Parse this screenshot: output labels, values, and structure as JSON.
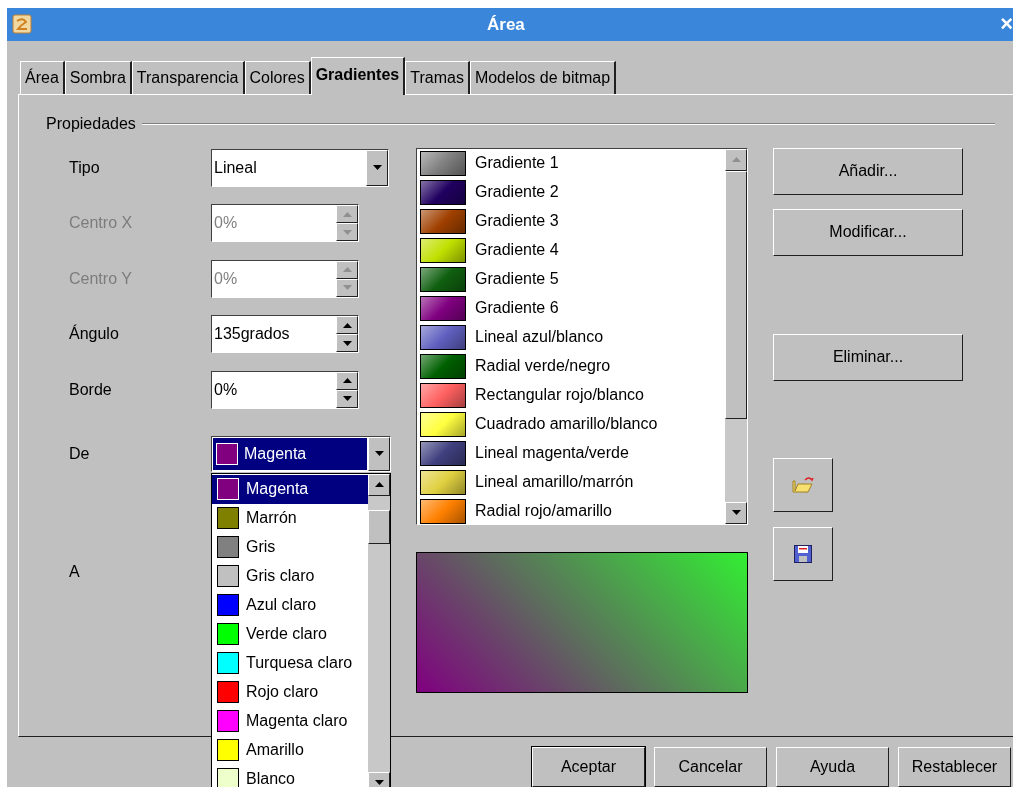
{
  "window": {
    "title": "Área",
    "close": "×"
  },
  "tabs": [
    {
      "label": "Área",
      "selected": false
    },
    {
      "label": "Sombra",
      "selected": false
    },
    {
      "label": "Transparencia",
      "selected": false
    },
    {
      "label": "Colores",
      "selected": false
    },
    {
      "label": "Gradientes",
      "selected": true
    },
    {
      "label": "Tramas",
      "selected": false
    },
    {
      "label": "Modelos de bitmap",
      "selected": false
    }
  ],
  "group": {
    "title": "Propiedades"
  },
  "fields": [
    {
      "kind": "dropdown",
      "label": "Tipo",
      "value": "Lineal",
      "disabled": false
    },
    {
      "kind": "spin",
      "label": "Centro X",
      "value": "0%",
      "disabled": true
    },
    {
      "kind": "spin",
      "label": "Centro Y",
      "value": "0%",
      "disabled": true
    },
    {
      "kind": "spin",
      "label": "Ángulo",
      "value": "135grados",
      "disabled": false
    },
    {
      "kind": "spin",
      "label": "Borde",
      "value": "0%",
      "disabled": false
    }
  ],
  "from": {
    "label": "De",
    "value": "Magenta",
    "color": "#800080",
    "expanded": true
  },
  "to": {
    "label": "A"
  },
  "color_options": [
    {
      "name": "Magenta",
      "color": "#800080",
      "selected": true
    },
    {
      "name": "Marrón",
      "color": "#808000",
      "selected": false
    },
    {
      "name": "Gris",
      "color": "#808080",
      "selected": false
    },
    {
      "name": "Gris claro",
      "color": "#c0c0c0",
      "selected": false
    },
    {
      "name": "Azul claro",
      "color": "#0000ff",
      "selected": false
    },
    {
      "name": "Verde claro",
      "color": "#00ff00",
      "selected": false
    },
    {
      "name": "Turquesa claro",
      "color": "#00ffff",
      "selected": false
    },
    {
      "name": "Rojo claro",
      "color": "#ff0000",
      "selected": false
    },
    {
      "name": "Magenta claro",
      "color": "#ff00ff",
      "selected": false
    },
    {
      "name": "Amarillo",
      "color": "#ffff00",
      "selected": false
    },
    {
      "name": "Blanco",
      "color": "#eeffcc",
      "selected": false
    }
  ],
  "gradients": [
    {
      "name": "Gradiente 1",
      "color": "#808080"
    },
    {
      "name": "Gradiente 2",
      "color": "#200060"
    },
    {
      "name": "Gradiente 3",
      "color": "#a04000"
    },
    {
      "name": "Gradiente 4",
      "color": "#c0e000"
    },
    {
      "name": "Gradiente 5",
      "color": "#106010"
    },
    {
      "name": "Gradiente 6",
      "color": "#800080"
    },
    {
      "name": "Lineal azul/blanco",
      "color": "#6060c0"
    },
    {
      "name": "Radial verde/negro",
      "color": "#006000"
    },
    {
      "name": "Rectangular rojo/blanco",
      "color": "#ff6060"
    },
    {
      "name": "Cuadrado amarillo/blanco",
      "color": "#ffff40"
    },
    {
      "name": "Lineal magenta/verde",
      "color": "#404080"
    },
    {
      "name": "Lineal amarillo/marrón",
      "color": "#e0d040"
    },
    {
      "name": "Radial rojo/amarillo",
      "color": "#ff8000"
    }
  ],
  "preview": {
    "color": "#33ee33"
  },
  "side_buttons": [
    {
      "label": "Añadir..."
    },
    {
      "label": "Modificar..."
    },
    {
      "label": "Eliminar..."
    }
  ],
  "footer_buttons": [
    {
      "label": "Aceptar",
      "default": true
    },
    {
      "label": "Cancelar",
      "default": false
    },
    {
      "label": "Ayuda",
      "default": false
    },
    {
      "label": "Restablecer",
      "default": false
    }
  ]
}
